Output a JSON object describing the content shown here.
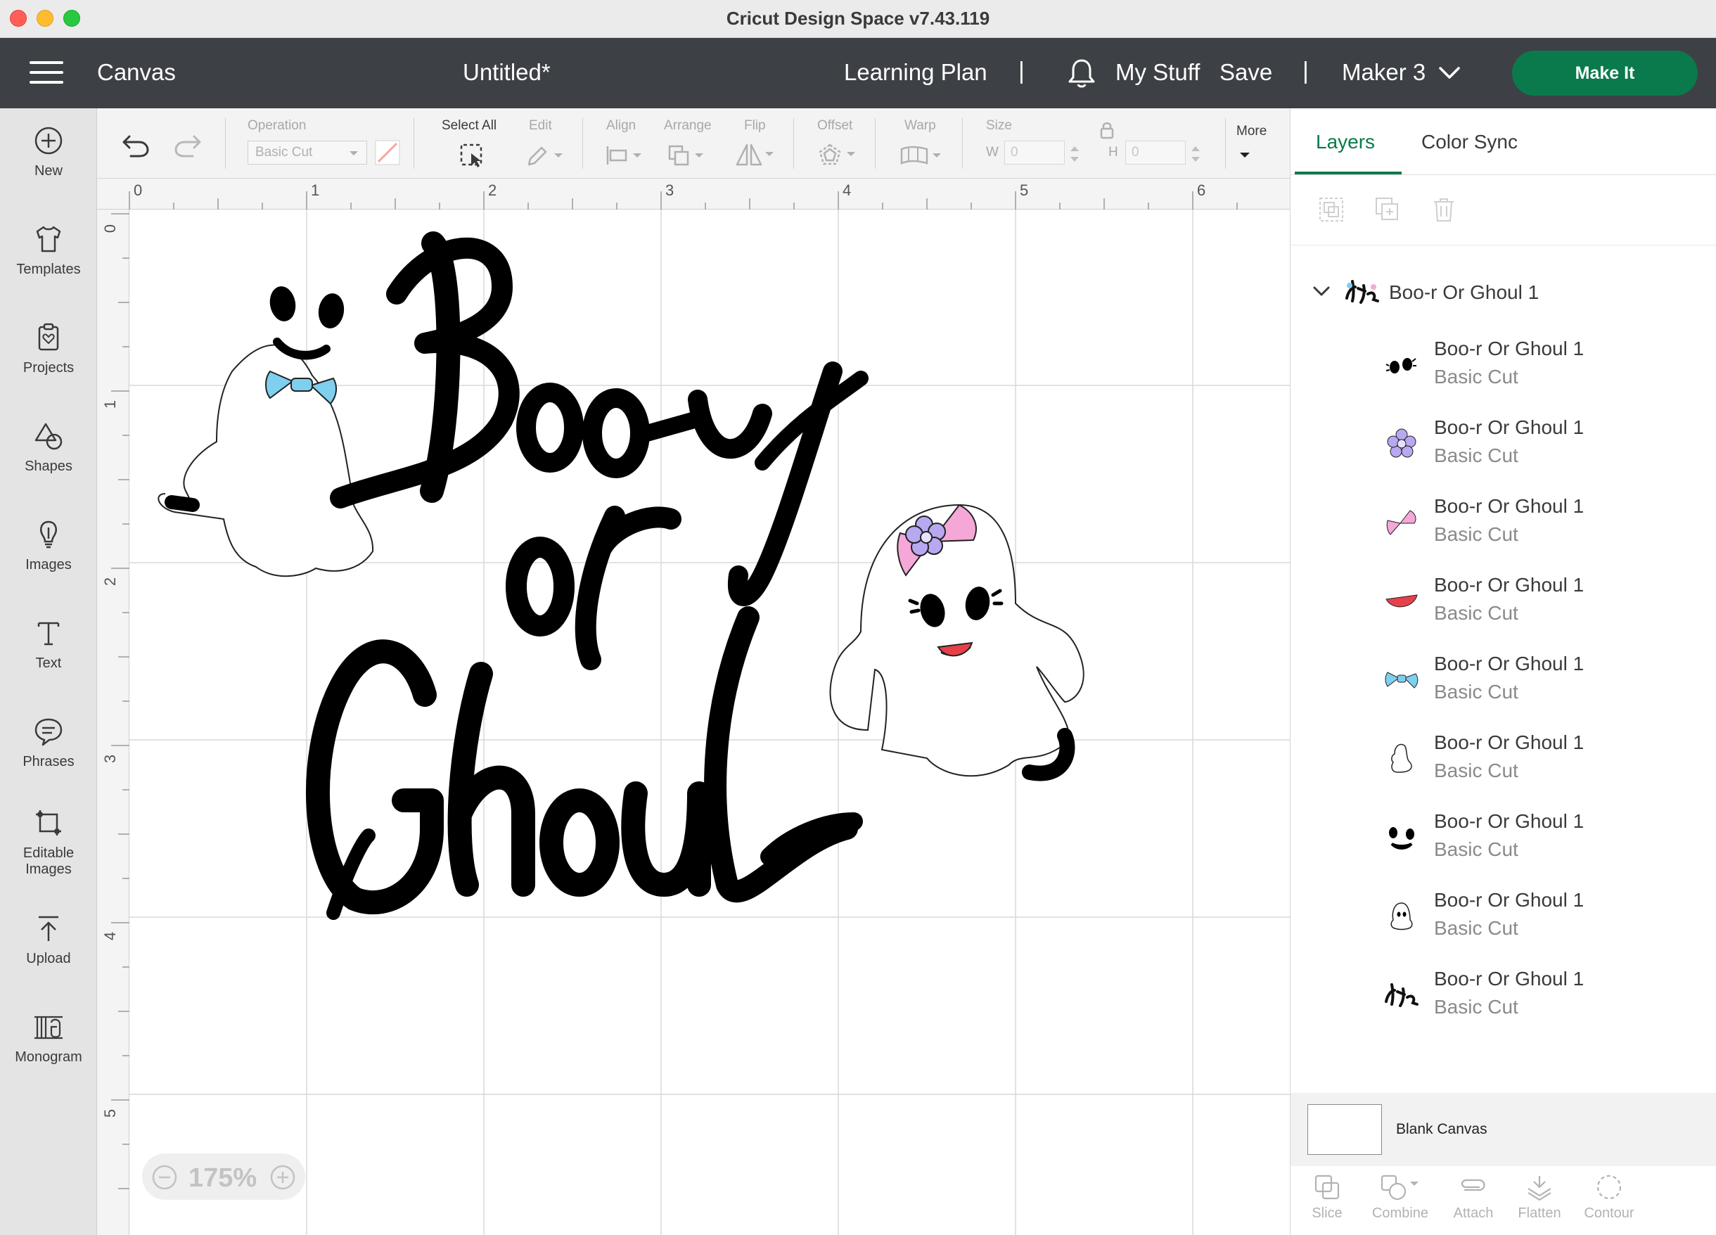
{
  "window": {
    "title": "Cricut Design Space  v7.43.119"
  },
  "header": {
    "section": "Canvas",
    "project_title": "Untitled*",
    "learning_plan": "Learning Plan",
    "separator": "|",
    "my_stuff": "My Stuff",
    "save": "Save",
    "machine": "Maker 3",
    "make_it": "Make It"
  },
  "sidebar": {
    "items": [
      {
        "label": "New",
        "icon": "plus-circle-icon"
      },
      {
        "label": "Templates",
        "icon": "shirt-icon"
      },
      {
        "label": "Projects",
        "icon": "clipboard-heart-icon"
      },
      {
        "label": "Shapes",
        "icon": "shapes-icon"
      },
      {
        "label": "Images",
        "icon": "lightbulb-icon"
      },
      {
        "label": "Text",
        "icon": "text-t-icon"
      },
      {
        "label": "Phrases",
        "icon": "speech-bubble-icon"
      },
      {
        "label": "Editable",
        "label2": "Images",
        "icon": "editable-images-icon"
      },
      {
        "label": "Upload",
        "icon": "upload-arrow-icon"
      },
      {
        "label": "Monogram",
        "icon": "monogram-icon"
      }
    ]
  },
  "toolbar": {
    "operation_label": "Operation",
    "operation_value": "Basic Cut",
    "select_all": "Select All",
    "edit": "Edit",
    "align": "Align",
    "arrange": "Arrange",
    "flip": "Flip",
    "offset": "Offset",
    "warp": "Warp",
    "size": "Size",
    "w_label": "W",
    "w_value": "0",
    "h_label": "H",
    "h_value": "0",
    "more": "More"
  },
  "canvas": {
    "ruler_top": [
      "0",
      "1",
      "2",
      "3",
      "4",
      "5",
      "6"
    ],
    "ruler_left": [
      "0",
      "1",
      "2",
      "3",
      "4",
      "5"
    ],
    "zoom": "175%",
    "design": {
      "line1": "Boo-y",
      "line2": "or",
      "line3": "Ghoul"
    }
  },
  "right_panel": {
    "tabs": [
      "Layers",
      "Color Sync"
    ],
    "group_name": "Boo-r Or Ghoul 1",
    "layers": [
      {
        "name": "Boo-r Or Ghoul 1",
        "operation": "Basic Cut",
        "thumb": "eyes-icon"
      },
      {
        "name": "Boo-r Or Ghoul 1",
        "operation": "Basic Cut",
        "thumb": "flower-icon"
      },
      {
        "name": "Boo-r Or Ghoul 1",
        "operation": "Basic Cut",
        "thumb": "pink-bow-icon"
      },
      {
        "name": "Boo-r Or Ghoul 1",
        "operation": "Basic Cut",
        "thumb": "mouth-icon"
      },
      {
        "name": "Boo-r Or Ghoul 1",
        "operation": "Basic Cut",
        "thumb": "blue-bow-icon"
      },
      {
        "name": "Boo-r Or Ghoul 1",
        "operation": "Basic Cut",
        "thumb": "ghost-outline-icon"
      },
      {
        "name": "Boo-r Or Ghoul 1",
        "operation": "Basic Cut",
        "thumb": "face-icon"
      },
      {
        "name": "Boo-r Or Ghoul 1",
        "operation": "Basic Cut",
        "thumb": "small-ghost-icon"
      },
      {
        "name": "Boo-r Or Ghoul 1",
        "operation": "Basic Cut",
        "thumb": "text-design-icon"
      }
    ],
    "blank_canvas": "Blank Canvas",
    "actions": [
      "Slice",
      "Combine",
      "Attach",
      "Flatten",
      "Contour"
    ]
  },
  "colors": {
    "accent_green": "#0a7a4c",
    "header_bg": "#3d4145",
    "sidebar_bg": "#e4e4e4",
    "blue_bow": "#7fcfef",
    "pink_bow": "#f5a8d8",
    "flower": "#b8a8f0",
    "mouth": "#e8404a"
  }
}
